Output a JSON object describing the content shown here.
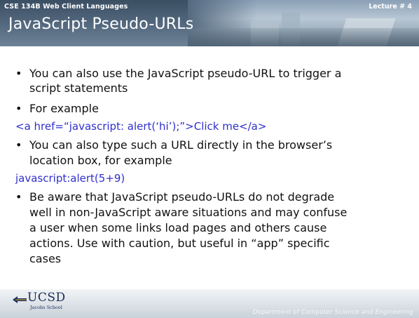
{
  "header": {
    "course": "CSE 134B  Web Client Languages",
    "lecture": "Lecture # 4",
    "title": "JavaScript Pseudo-URLs"
  },
  "bullets": {
    "b1_line1": "You can also use the JavaScript pseudo-URL to trigger a",
    "b1_line2": "script statements",
    "b2": "For example",
    "code1": "<a href=“javascript: alert(‘hi’);”>Click me</a>",
    "b3_line1": "You can also type such a URL directly in the browser’s",
    "b3_line2": "location box, for example",
    "code2": "javascript:alert(5+9)",
    "b4_line1": "Be aware that JavaScript pseudo-URLs do not degrade",
    "b4_line2": "well in non-JavaScript aware situations and may confuse",
    "b4_line3": "a user when some links load pages and others cause",
    "b4_line4": "actions.  Use with caution, but useful in “app” specific",
    "b4_line5": "cases"
  },
  "footer": {
    "logo_text": "UCSD",
    "logo_sub": "Jacobs School",
    "department": "Department of Computer Science and Engineering"
  },
  "colors": {
    "header_bg": "#556a80",
    "code_text": "#2f2fd0",
    "body_text": "#111111"
  }
}
